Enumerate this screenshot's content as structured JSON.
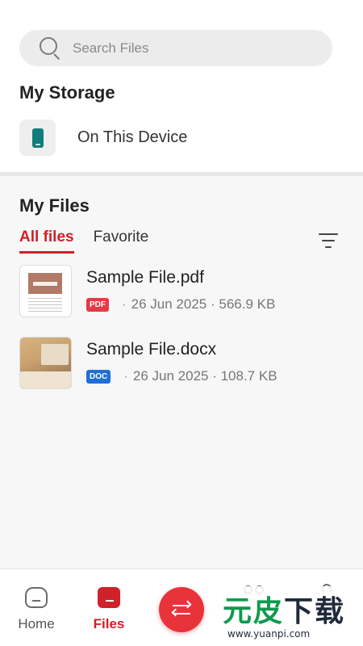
{
  "search": {
    "placeholder": "Search Files"
  },
  "storage": {
    "title": "My Storage",
    "device_label": "On This Device"
  },
  "files": {
    "title": "My Files",
    "tabs": [
      {
        "label": "All files",
        "active": true
      },
      {
        "label": "Favorite",
        "active": false
      }
    ],
    "items": [
      {
        "name": "Sample File.pdf",
        "badge": "PDF",
        "badge_color": "#e53a44",
        "separator": "·",
        "date": "26 Jun 2025 · 566.9 KB"
      },
      {
        "name": "Sample File.docx",
        "badge": "DOC",
        "badge_color": "#1f6fd6",
        "separator": "·",
        "date": "26 Jun 2025 · 108.7 KB"
      }
    ]
  },
  "nav": {
    "home": "Home",
    "files": "Files"
  },
  "watermark": {
    "brand_green": "元皮",
    "brand_dark": "下载",
    "url": "www.yuanpi.com"
  },
  "colors": {
    "accent": "#d0202a",
    "transfer": "#e8333a",
    "device_icon": "#0f7e7c"
  },
  "icons": [
    "search-icon",
    "phone-icon",
    "filter-icon",
    "home-icon",
    "files-icon",
    "transfer-icon",
    "apps-icon",
    "bag-icon"
  ]
}
